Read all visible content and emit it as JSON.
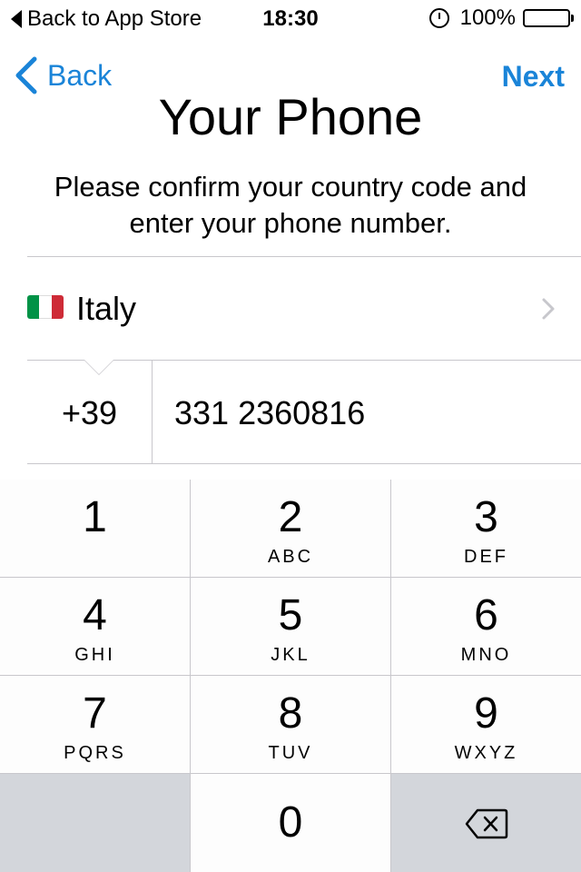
{
  "status_bar": {
    "back_to_app": "Back to App Store",
    "time": "18:30",
    "battery": "100%"
  },
  "nav": {
    "back_label": "Back",
    "next_label": "Next"
  },
  "title": "Your Phone",
  "subtitle": "Please confirm your country code and enter your phone number.",
  "country": {
    "name": "Italy",
    "flag_colors": [
      "#009246",
      "#ffffff",
      "#ce2b37"
    ]
  },
  "phone": {
    "country_code": "+39",
    "number": "331 2360816"
  },
  "keypad": {
    "keys": [
      {
        "digit": "1",
        "letters": ""
      },
      {
        "digit": "2",
        "letters": "ABC"
      },
      {
        "digit": "3",
        "letters": "DEF"
      },
      {
        "digit": "4",
        "letters": "GHI"
      },
      {
        "digit": "5",
        "letters": "JKL"
      },
      {
        "digit": "6",
        "letters": "MNO"
      },
      {
        "digit": "7",
        "letters": "PQRS"
      },
      {
        "digit": "8",
        "letters": "TUV"
      },
      {
        "digit": "9",
        "letters": "WXYZ"
      },
      {
        "digit": "0",
        "letters": ""
      }
    ]
  },
  "colors": {
    "accent": "#1a84d8",
    "divider": "#c8c7cc"
  }
}
